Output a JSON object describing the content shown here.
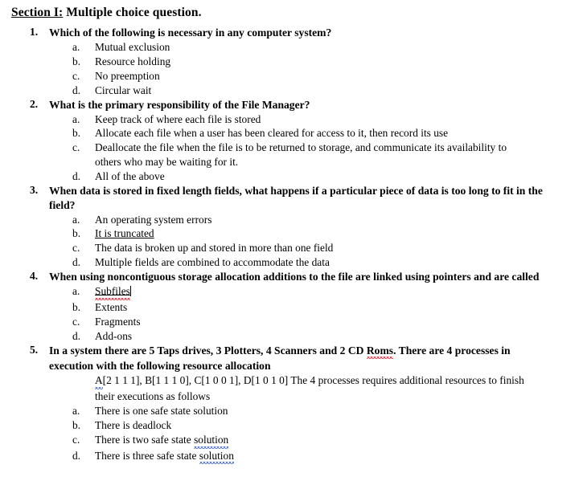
{
  "document": {
    "section": {
      "label": "Section I:",
      "title": "Multiple choice question."
    },
    "questions": [
      {
        "number": "1.",
        "text": "Which of the following is necessary in any computer system?",
        "options": [
          {
            "letter": "a.",
            "text": "Mutual exclusion"
          },
          {
            "letter": "b.",
            "text": "Resource holding"
          },
          {
            "letter": "c.",
            "text": "No preemption"
          },
          {
            "letter": "d.",
            "text": "Circular wait"
          }
        ]
      },
      {
        "number": "2.",
        "text": "What is the primary responsibility of the File Manager?",
        "options": [
          {
            "letter": "a.",
            "text": "Keep track of where each file is stored"
          },
          {
            "letter": "b.",
            "text": "Allocate each file when a user has been cleared for access to it, then record its use"
          },
          {
            "letter": "c.",
            "text": "Deallocate the file when the file is to be returned to storage, and communicate its availability to others who may be waiting for it."
          },
          {
            "letter": "d.",
            "text": "All of the above"
          }
        ]
      },
      {
        "number": "3.",
        "text": "When data is stored in fixed length fields, what happens if a particular piece of data is too long to fit in the field?",
        "options": [
          {
            "letter": "a.",
            "text": "An operating system errors"
          },
          {
            "letter": "b.",
            "text": "It is truncated",
            "underlined": true
          },
          {
            "letter": "c.",
            "text": "The data is broken up and stored in more than one field"
          },
          {
            "letter": "d.",
            "text": "Multiple fields are combined to accommodate the data"
          }
        ]
      },
      {
        "number": "4.",
        "text": "When using noncontiguous storage allocation additions to the file are linked using pointers and are called",
        "options": [
          {
            "letter": "a.",
            "text": "Subfiles",
            "underlined": true,
            "spellcheck": "red",
            "caret": true
          },
          {
            "letter": "b.",
            "text": "Extents"
          },
          {
            "letter": "c.",
            "text": "Fragments"
          },
          {
            "letter": "d.",
            "text": "Add-ons"
          }
        ]
      },
      {
        "number": "5.",
        "text_part1": "In a system there are 5 Taps drives, 3 Plotters, 4 Scanners and 2 CD ",
        "text_flagged": "Roms",
        "text_part2": ". There are 4 processes in execution with the following resource allocation",
        "allocation": {
          "flagged_start": "A",
          "rest": "[2 1 1 1], B[1 1 1 0], C[1 0 0 1], D[1 0 1 0] The 4 processes requires additional resources to finish their executions as follows"
        },
        "options": [
          {
            "letter": "a.",
            "text": "There is one safe state solution"
          },
          {
            "letter": "b.",
            "text": "There is deadlock"
          },
          {
            "letter": "c.",
            "text_pre": "There is two safe state ",
            "text_flagged": "solution",
            "spellcheck": "blue"
          },
          {
            "letter": "d.",
            "text_pre": "There is three safe state ",
            "text_flagged": "solution",
            "spellcheck": "blue"
          }
        ]
      }
    ]
  },
  "colors": {
    "spellcheck_red": "#e81123",
    "grammar_blue": "#2b57c4",
    "text": "#000000",
    "background": "#ffffff"
  }
}
